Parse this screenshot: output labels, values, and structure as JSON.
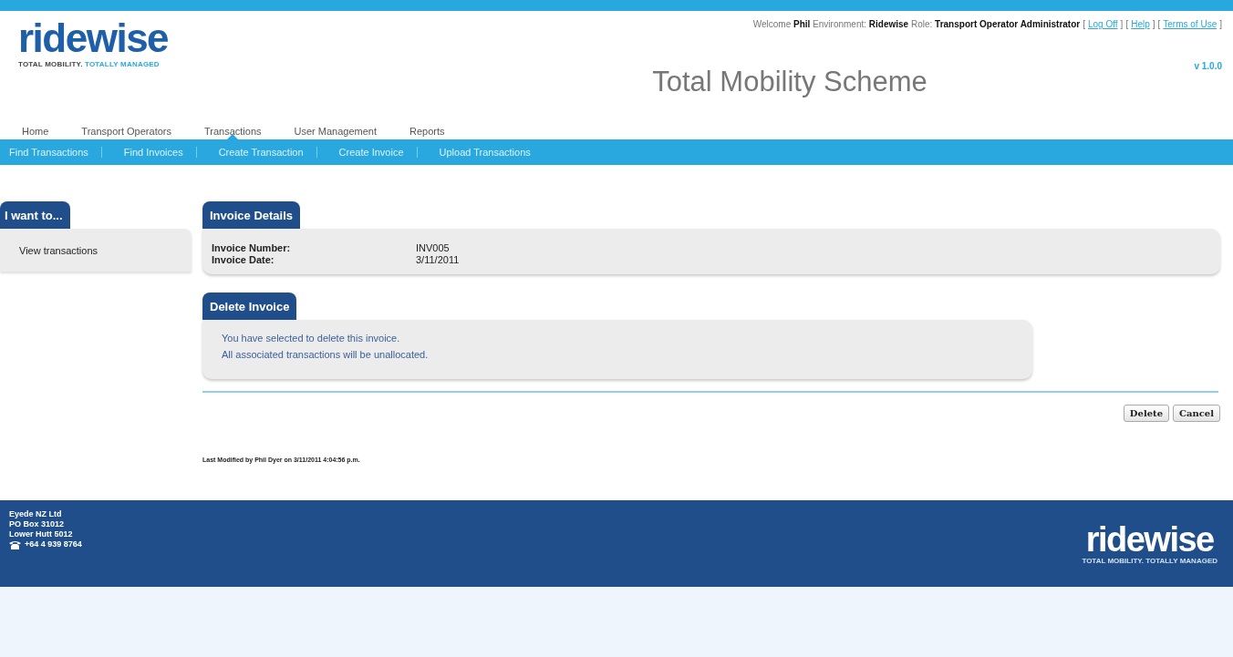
{
  "header": {
    "logo": "ridewise",
    "tagline_dark": "TOTAL MOBILITY.",
    "tagline_light": "TOTALLY MANAGED",
    "user_info": "Welcome **Phil** Environment: **Ridewise** Role: **Transport Operator Administrator**",
    "bracket_open": "[",
    "bracket_close": "]",
    "links": [
      "Log Off",
      "Help",
      "Terms of Use"
    ],
    "title": "Total Mobility Scheme",
    "version": "v 1.0.0"
  },
  "nav": [
    {
      "label": "Home",
      "selected": false
    },
    {
      "label": "Transport Operators",
      "selected": false
    },
    {
      "label": "Transactions",
      "selected": true
    },
    {
      "label": "User Management",
      "selected": false
    },
    {
      "label": "Reports",
      "selected": false
    }
  ],
  "subnav": [
    "Find Transactions",
    "Find Invoices",
    "Create Transaction",
    "Create Invoice",
    "Upload Transactions"
  ],
  "sidebar": {
    "title": "I want to...",
    "items": [
      "View transactions"
    ]
  },
  "invoice_details": {
    "title": "Invoice Details",
    "fields": [
      {
        "label": "Invoice Number:",
        "value": "INV005"
      },
      {
        "label": "Invoice Date:",
        "value": "3/11/2011"
      }
    ]
  },
  "delete_invoice": {
    "title": "Delete Invoice",
    "lines": [
      "You have selected to delete this invoice.",
      "All associated transactions will be unallocated."
    ]
  },
  "buttons": [
    "Delete",
    "Cancel"
  ],
  "last_modified": "Last Modified by Phil Dyer on 3/11/2011 4:04:56 p.m.",
  "footer": {
    "address": [
      "Eyede NZ Ltd",
      "PO Box 31012",
      "Lower Hutt 5012"
    ],
    "phone": "+64 4 939 8764",
    "logo": "ridewise",
    "tagline": "TOTAL MOBILITY. TOTALLY MANAGED"
  }
}
